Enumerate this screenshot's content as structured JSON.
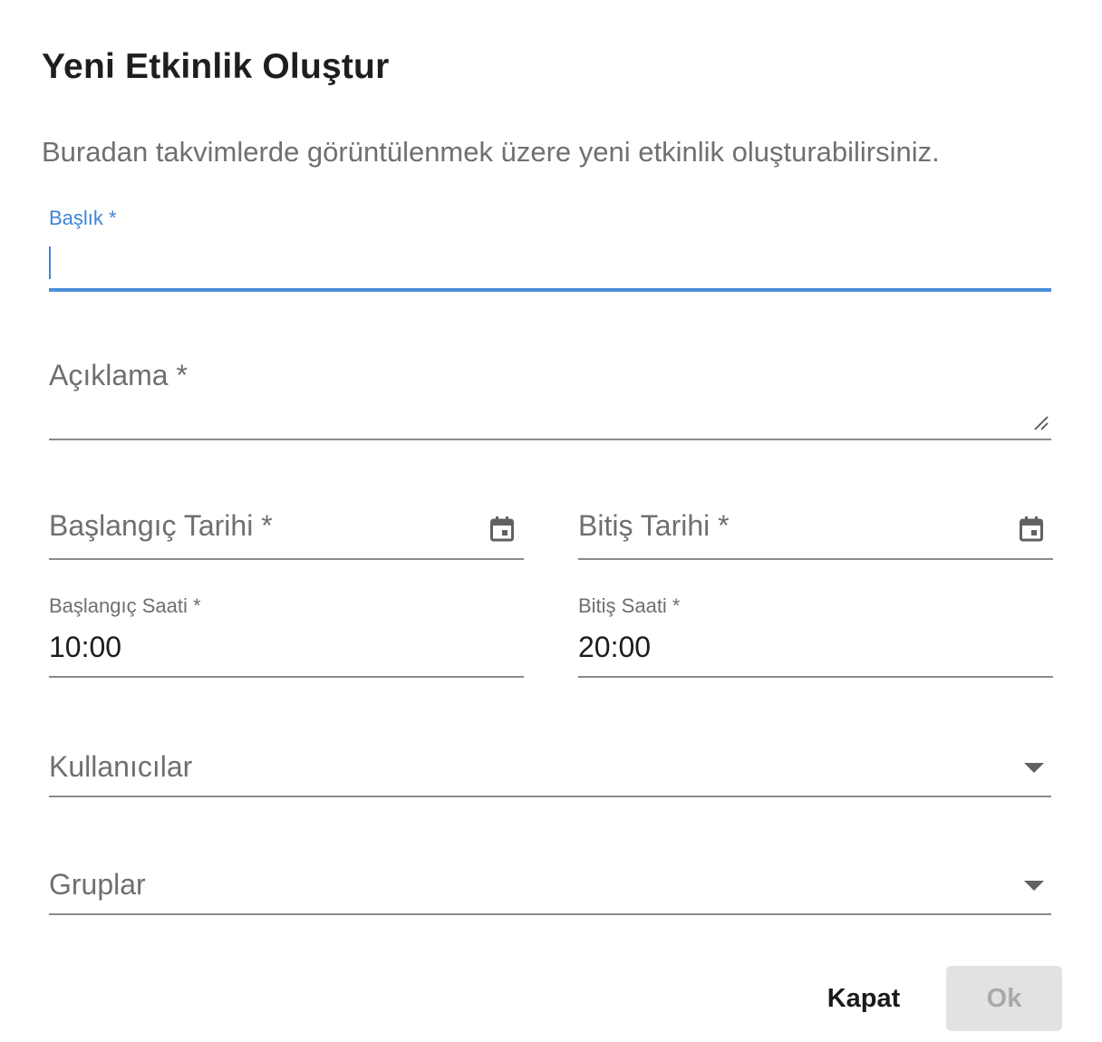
{
  "dialog": {
    "title": "Yeni Etkinlik Oluştur",
    "subtitle": "Buradan takvimlerde görüntülenmek üzere yeni etkinlik oluşturabilirsiniz."
  },
  "fields": {
    "title": {
      "label": "Başlık *",
      "value": ""
    },
    "description": {
      "label": "Açıklama *",
      "value": ""
    },
    "start_date": {
      "label": "Başlangıç Tarihi *",
      "icon": "calendar-icon"
    },
    "end_date": {
      "label": "Bitiş Tarihi *",
      "icon": "calendar-icon"
    },
    "start_time": {
      "label": "Başlangıç Saati *",
      "value": "10:00"
    },
    "end_time": {
      "label": "Bitiş Saati *",
      "value": "20:00"
    },
    "users": {
      "label": "Kullanıcılar",
      "icon": "dropdown-arrow-icon"
    },
    "groups": {
      "label": "Gruplar",
      "icon": "dropdown-arrow-icon"
    }
  },
  "actions": {
    "close_label": "Kapat",
    "ok_label": "Ok"
  },
  "colors": {
    "accent": "#4a8edc",
    "underline": "#8a8a8a",
    "disabled_bg": "#e2e2e2",
    "disabled_text": "#a9a9a9"
  }
}
